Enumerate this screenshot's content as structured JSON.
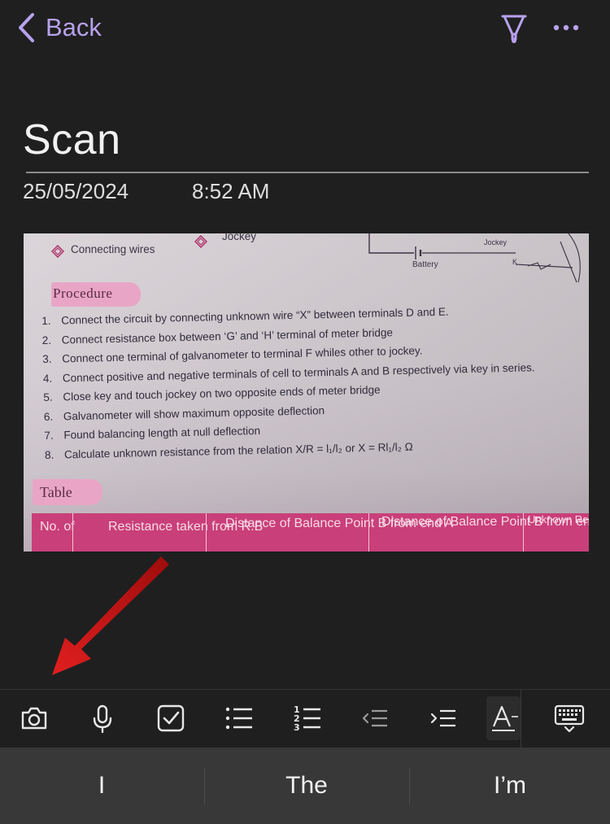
{
  "nav": {
    "back_label": "Back",
    "pen_icon": "pen-marker-icon",
    "more_icon": "more-dots-icon",
    "accent_color": "#b7a2ec"
  },
  "note": {
    "title": "Scan",
    "date": "25/05/2024",
    "time": "8:52 AM"
  },
  "photo": {
    "top_items": [
      "Connecting wires",
      "Jockey"
    ],
    "circuit_labels": [
      "Battery",
      "Jockey",
      "K"
    ],
    "procedure_heading": "Procedure",
    "procedure_steps": [
      {
        "num": "1.",
        "text": "Connect the circuit by connecting unknown wire “X” between terminals D and E."
      },
      {
        "num": "2.",
        "text": "Connect resistance box between ‘G’ and ‘H’ terminal of meter bridge"
      },
      {
        "num": "3.",
        "text": "Connect one terminal of galvanometer to terminal F whiles other to jockey."
      },
      {
        "num": "4.",
        "text": "Connect positive and negative terminals of cell to terminals A and B respectively via key in series."
      },
      {
        "num": "5.",
        "text": "Close key and touch jockey on two opposite ends of meter bridge"
      },
      {
        "num": "6.",
        "text": "Galvanometer will show maximum opposite deflection"
      },
      {
        "num": "7.",
        "text": "Found balancing length at null deflection"
      },
      {
        "num": "8.",
        "text": "Calculate unknown resistance from the relation X/R = l₁/l₂ or X = Rl₁/l₂ Ω"
      }
    ],
    "table_heading": "Table",
    "table_headers": [
      "No. of",
      "Resistance taken from R.B",
      "Distance of Balance Point B from end A",
      "Distance of Balance Point B from end C",
      "Unknown Resista"
    ],
    "header_color": "#c93f79"
  },
  "toolbar": {
    "items": [
      {
        "icon": "camera-icon"
      },
      {
        "icon": "microphone-icon"
      },
      {
        "icon": "checkbox-icon"
      },
      {
        "icon": "bulleted-list-icon"
      },
      {
        "icon": "numbered-list-icon"
      },
      {
        "icon": "outdent-icon"
      },
      {
        "icon": "indent-icon"
      },
      {
        "icon": "text-format-icon"
      },
      {
        "icon": "hide-keyboard-icon"
      }
    ]
  },
  "suggestions": [
    "I",
    "The",
    "I’m"
  ],
  "annotation_arrow_color": "#d41b1b"
}
